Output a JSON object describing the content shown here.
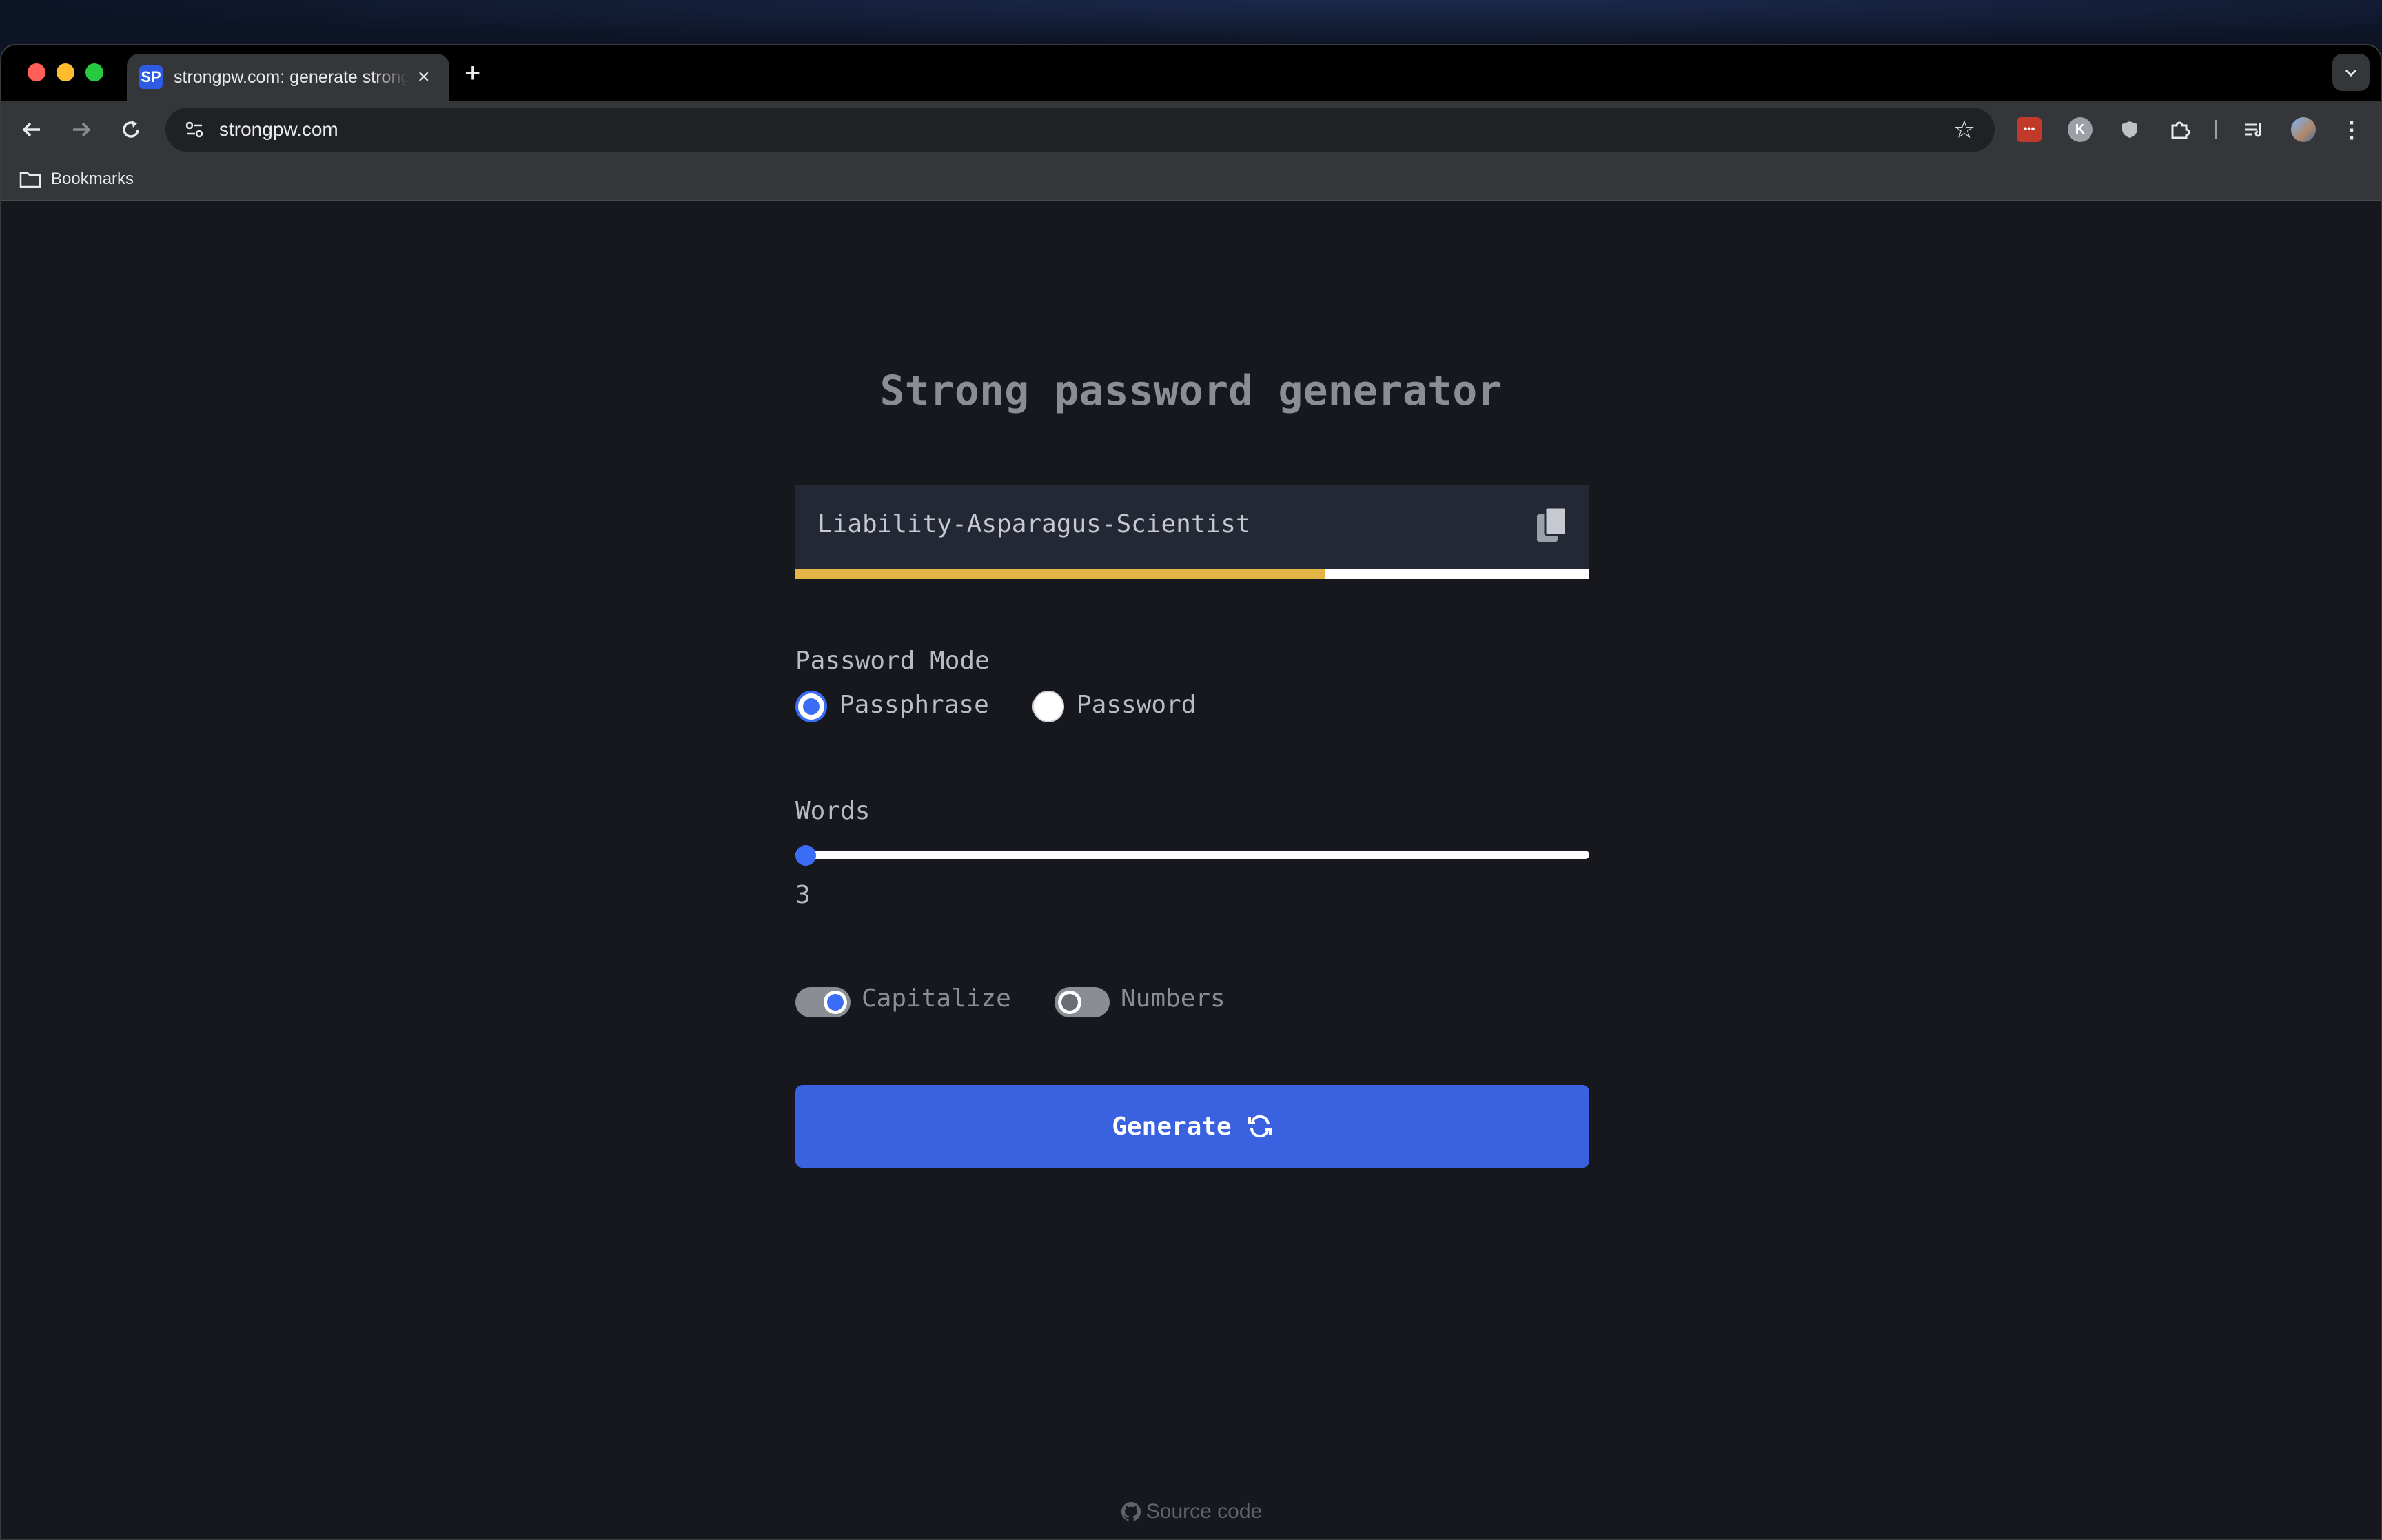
{
  "browser": {
    "tab": {
      "favicon_text": "SP",
      "title": "strongpw.com: generate strong passwords",
      "close": "×"
    },
    "new_tab": "+",
    "address_bar": {
      "url": "strongpw.com"
    },
    "bookmarks_bar": {
      "label": "Bookmarks"
    }
  },
  "page": {
    "title": "Strong password generator",
    "generated_password": "Liability-Asparagus-Scientist",
    "strength_fraction": 0.667,
    "mode": {
      "label": "Password Mode",
      "options": [
        {
          "label": "Passphrase",
          "selected": true
        },
        {
          "label": "Password",
          "selected": false
        }
      ]
    },
    "words": {
      "label": "Words",
      "value": "3"
    },
    "toggles": {
      "capitalize": {
        "label": "Capitalize",
        "on": true
      },
      "numbers": {
        "label": "Numbers",
        "on": false
      }
    },
    "generate_button": {
      "label": "Generate"
    },
    "footer": {
      "source_code": "Source code"
    }
  },
  "colors": {
    "accent": "#3961e0",
    "strength_bar": "#e3b544",
    "page_background": "#16181d"
  }
}
